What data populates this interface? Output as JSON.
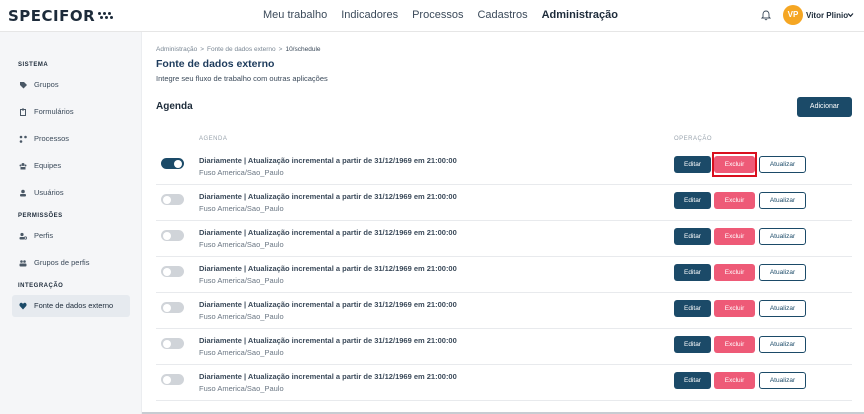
{
  "header": {
    "logo": "SPECIFOR",
    "nav": [
      "Meu trabalho",
      "Indicadores",
      "Processos",
      "Cadastros",
      "Administração"
    ],
    "active_nav": "Administração",
    "avatar_initials": "VP",
    "user_name": "Vitor Plinio"
  },
  "sidebar": {
    "sections": [
      {
        "label": "SISTEMA",
        "items": [
          {
            "label": "Grupos",
            "icon": "tag-icon"
          },
          {
            "label": "Formulários",
            "icon": "clipboard-icon"
          },
          {
            "label": "Processos",
            "icon": "flow-icon"
          },
          {
            "label": "Equipes",
            "icon": "team-icon"
          },
          {
            "label": "Usuários",
            "icon": "user-icon"
          }
        ]
      },
      {
        "label": "PERMISSÕES",
        "items": [
          {
            "label": "Perfis",
            "icon": "profile-icon"
          },
          {
            "label": "Grupos de perfis",
            "icon": "profile-group-icon"
          }
        ]
      },
      {
        "label": "INTEGRAÇÃO",
        "items": [
          {
            "label": "Fonte de dados externo",
            "icon": "heart-icon",
            "active": true
          }
        ]
      }
    ]
  },
  "breadcrumb": [
    "Administração",
    "Fonte de dados externo",
    "10/schedule"
  ],
  "breadcrumb_sep": ">",
  "page": {
    "title": "Fonte de dados externo",
    "subtitle": "Integre seu fluxo de trabalho com outras aplicações",
    "section_title": "Agenda",
    "add_label": "Adicionar"
  },
  "table": {
    "col_agenda": "AGENDA",
    "col_operacao": "OPERAÇÃO",
    "rows": [
      {
        "enabled": true,
        "title": "Diariamente | Atualização incremental a partir de 31/12/1969 em 21:00:00",
        "timezone": "Fuso America/Sao_Paulo"
      },
      {
        "enabled": false,
        "title": "Diariamente | Atualização incremental a partir de 31/12/1969 em 21:00:00",
        "timezone": "Fuso America/Sao_Paulo"
      },
      {
        "enabled": false,
        "title": "Diariamente | Atualização incremental a partir de 31/12/1969 em 21:00:00",
        "timezone": "Fuso America/Sao_Paulo"
      },
      {
        "enabled": false,
        "title": "Diariamente | Atualização incremental a partir de 31/12/1969 em 21:00:00",
        "timezone": "Fuso America/Sao_Paulo"
      },
      {
        "enabled": false,
        "title": "Diariamente | Atualização incremental a partir de 31/12/1969 em 21:00:00",
        "timezone": "Fuso America/Sao_Paulo"
      },
      {
        "enabled": false,
        "title": "Diariamente | Atualização incremental a partir de 31/12/1969 em 21:00:00",
        "timezone": "Fuso America/Sao_Paulo"
      },
      {
        "enabled": false,
        "title": "Diariamente | Atualização incremental a partir de 31/12/1969 em 21:00:00",
        "timezone": "Fuso America/Sao_Paulo"
      }
    ],
    "edit_label": "Editar",
    "delete_label": "Excluir",
    "update_label": "Atualizar"
  },
  "colors": {
    "primary": "#1b4a68",
    "danger": "#ee5a77",
    "highlight": "#d90f1e",
    "avatar": "#f5a623"
  }
}
